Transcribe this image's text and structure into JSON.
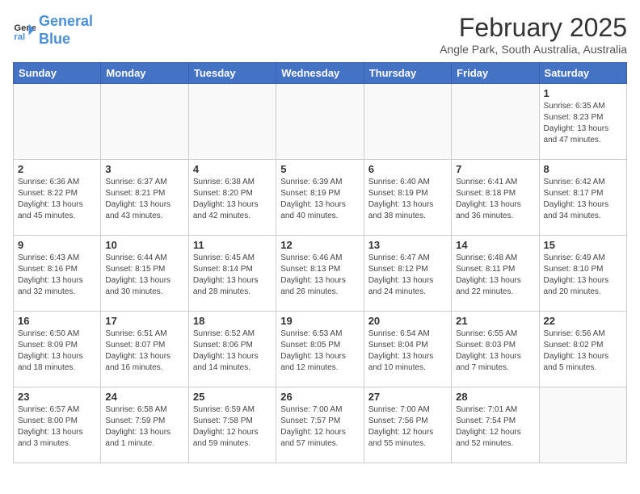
{
  "logo": {
    "line1": "General",
    "line2": "Blue"
  },
  "title": "February 2025",
  "location": "Angle Park, South Australia, Australia",
  "days_of_week": [
    "Sunday",
    "Monday",
    "Tuesday",
    "Wednesday",
    "Thursday",
    "Friday",
    "Saturday"
  ],
  "weeks": [
    [
      {
        "day": "",
        "info": ""
      },
      {
        "day": "",
        "info": ""
      },
      {
        "day": "",
        "info": ""
      },
      {
        "day": "",
        "info": ""
      },
      {
        "day": "",
        "info": ""
      },
      {
        "day": "",
        "info": ""
      },
      {
        "day": "1",
        "info": "Sunrise: 6:35 AM\nSunset: 8:23 PM\nDaylight: 13 hours and 47 minutes."
      }
    ],
    [
      {
        "day": "2",
        "info": "Sunrise: 6:36 AM\nSunset: 8:22 PM\nDaylight: 13 hours and 45 minutes."
      },
      {
        "day": "3",
        "info": "Sunrise: 6:37 AM\nSunset: 8:21 PM\nDaylight: 13 hours and 43 minutes."
      },
      {
        "day": "4",
        "info": "Sunrise: 6:38 AM\nSunset: 8:20 PM\nDaylight: 13 hours and 42 minutes."
      },
      {
        "day": "5",
        "info": "Sunrise: 6:39 AM\nSunset: 8:19 PM\nDaylight: 13 hours and 40 minutes."
      },
      {
        "day": "6",
        "info": "Sunrise: 6:40 AM\nSunset: 8:19 PM\nDaylight: 13 hours and 38 minutes."
      },
      {
        "day": "7",
        "info": "Sunrise: 6:41 AM\nSunset: 8:18 PM\nDaylight: 13 hours and 36 minutes."
      },
      {
        "day": "8",
        "info": "Sunrise: 6:42 AM\nSunset: 8:17 PM\nDaylight: 13 hours and 34 minutes."
      }
    ],
    [
      {
        "day": "9",
        "info": "Sunrise: 6:43 AM\nSunset: 8:16 PM\nDaylight: 13 hours and 32 minutes."
      },
      {
        "day": "10",
        "info": "Sunrise: 6:44 AM\nSunset: 8:15 PM\nDaylight: 13 hours and 30 minutes."
      },
      {
        "day": "11",
        "info": "Sunrise: 6:45 AM\nSunset: 8:14 PM\nDaylight: 13 hours and 28 minutes."
      },
      {
        "day": "12",
        "info": "Sunrise: 6:46 AM\nSunset: 8:13 PM\nDaylight: 13 hours and 26 minutes."
      },
      {
        "day": "13",
        "info": "Sunrise: 6:47 AM\nSunset: 8:12 PM\nDaylight: 13 hours and 24 minutes."
      },
      {
        "day": "14",
        "info": "Sunrise: 6:48 AM\nSunset: 8:11 PM\nDaylight: 13 hours and 22 minutes."
      },
      {
        "day": "15",
        "info": "Sunrise: 6:49 AM\nSunset: 8:10 PM\nDaylight: 13 hours and 20 minutes."
      }
    ],
    [
      {
        "day": "16",
        "info": "Sunrise: 6:50 AM\nSunset: 8:09 PM\nDaylight: 13 hours and 18 minutes."
      },
      {
        "day": "17",
        "info": "Sunrise: 6:51 AM\nSunset: 8:07 PM\nDaylight: 13 hours and 16 minutes."
      },
      {
        "day": "18",
        "info": "Sunrise: 6:52 AM\nSunset: 8:06 PM\nDaylight: 13 hours and 14 minutes."
      },
      {
        "day": "19",
        "info": "Sunrise: 6:53 AM\nSunset: 8:05 PM\nDaylight: 13 hours and 12 minutes."
      },
      {
        "day": "20",
        "info": "Sunrise: 6:54 AM\nSunset: 8:04 PM\nDaylight: 13 hours and 10 minutes."
      },
      {
        "day": "21",
        "info": "Sunrise: 6:55 AM\nSunset: 8:03 PM\nDaylight: 13 hours and 7 minutes."
      },
      {
        "day": "22",
        "info": "Sunrise: 6:56 AM\nSunset: 8:02 PM\nDaylight: 13 hours and 5 minutes."
      }
    ],
    [
      {
        "day": "23",
        "info": "Sunrise: 6:57 AM\nSunset: 8:00 PM\nDaylight: 13 hours and 3 minutes."
      },
      {
        "day": "24",
        "info": "Sunrise: 6:58 AM\nSunset: 7:59 PM\nDaylight: 13 hours and 1 minute."
      },
      {
        "day": "25",
        "info": "Sunrise: 6:59 AM\nSunset: 7:58 PM\nDaylight: 12 hours and 59 minutes."
      },
      {
        "day": "26",
        "info": "Sunrise: 7:00 AM\nSunset: 7:57 PM\nDaylight: 12 hours and 57 minutes."
      },
      {
        "day": "27",
        "info": "Sunrise: 7:00 AM\nSunset: 7:56 PM\nDaylight: 12 hours and 55 minutes."
      },
      {
        "day": "28",
        "info": "Sunrise: 7:01 AM\nSunset: 7:54 PM\nDaylight: 12 hours and 52 minutes."
      },
      {
        "day": "",
        "info": ""
      }
    ]
  ]
}
